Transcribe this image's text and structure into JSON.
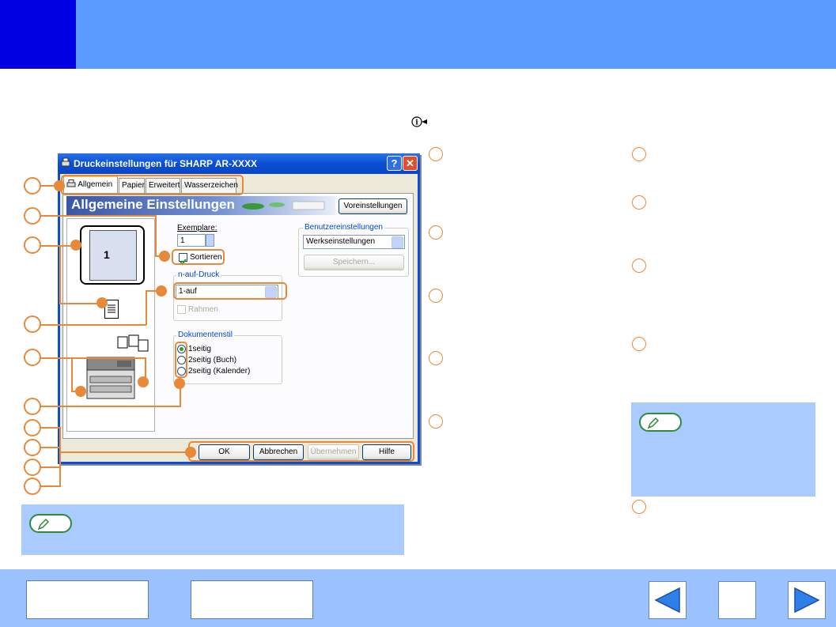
{
  "dialog": {
    "title": "Druckeinstellungen für SHARP AR-XXXX",
    "help_btn": "?",
    "close_btn": "✕",
    "tabs": [
      "Allgemein",
      "Papier",
      "Erweitert",
      "Wasserzeichen"
    ],
    "banner": "Allgemeine Einstellungen",
    "defaults_button": "Voreinstellungen",
    "copies_label": "Exemplare:",
    "copies_value": "1",
    "collate_label": "Sortieren",
    "nup_group": "n-auf-Druck",
    "nup_value": "1-auf",
    "border_label": "Rahmen",
    "doc_style_group": "Dokumentenstil",
    "doc_style_options": [
      "1seitig",
      "2seitig (Buch)",
      "2seitig (Kalender)"
    ],
    "user_settings_group": "Benutzereinstellungen",
    "user_settings_value": "Werkseinstellungen",
    "save_button": "Speichern...",
    "preview_page": "1",
    "buttons": {
      "ok": "OK",
      "cancel": "Abbrechen",
      "apply": "Übernehmen",
      "help": "Hilfe"
    }
  },
  "colors": {
    "header": "#5b9bff",
    "chapter_block": "#0000e0",
    "footer": "#9cc1ff",
    "callout": "#e8893a",
    "note_box": "#a9cbff",
    "note_pill_border": "#2f8a3c"
  },
  "icons": {
    "info": "info-pointer-icon",
    "note": "pencil-icon",
    "prev": "left-arrow-icon",
    "next": "right-arrow-icon"
  }
}
